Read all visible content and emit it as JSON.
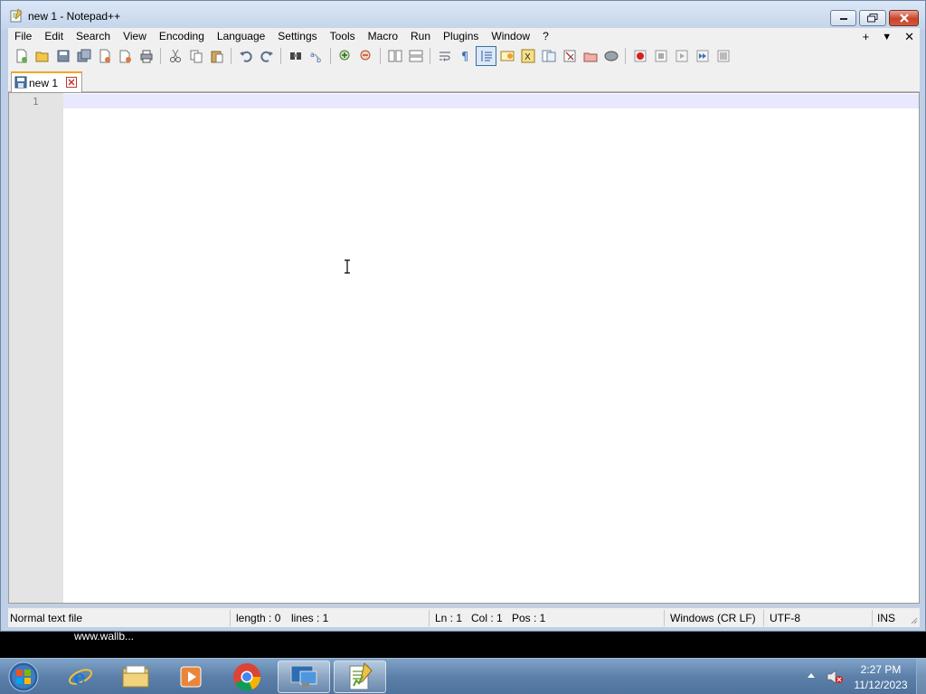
{
  "window": {
    "title": "new 1 - Notepad++",
    "app_icon": "notepadpp-icon"
  },
  "menubar": {
    "items": [
      "File",
      "Edit",
      "Search",
      "View",
      "Encoding",
      "Language",
      "Settings",
      "Tools",
      "Macro",
      "Run",
      "Plugins",
      "Window",
      "?"
    ],
    "right": {
      "plus": "+",
      "dropdown": "▼",
      "close": "✕"
    }
  },
  "toolbar": {
    "icons": [
      "new-file-icon",
      "open-file-icon",
      "save-icon",
      "save-all-icon",
      "close-icon",
      "close-all-icon",
      "print-icon",
      "cut-icon",
      "copy-icon",
      "paste-icon",
      "undo-icon",
      "redo-icon",
      "find-icon",
      "replace-icon",
      "zoom-in-icon",
      "zoom-out-icon",
      "sync-vertical-icon",
      "sync-horizontal-icon",
      "word-wrap-icon",
      "show-all-chars-icon",
      "indent-guide-icon",
      "udl-icon",
      "function-list-icon",
      "doc-map-icon",
      "doc-list-icon",
      "folder-workspace-icon",
      "monitoring-icon",
      "record-macro-icon",
      "stop-macro-icon",
      "play-macro-icon",
      "run-macro-multiple-icon",
      "save-macro-icon"
    ]
  },
  "tabs": [
    {
      "label": "new 1",
      "active": true
    }
  ],
  "editor": {
    "line_numbers": [
      "1"
    ],
    "content": ""
  },
  "statusbar": {
    "file_type": "Normal text file",
    "length": "length : 0",
    "lines": "lines : 1",
    "ln": "Ln : 1",
    "col": "Col : 1",
    "pos": "Pos : 1",
    "eol": "Windows (CR LF)",
    "encoding": "UTF-8",
    "mode": "INS"
  },
  "tooltip": "www.wallb...",
  "taskbar": {
    "apps": [
      "internet-explorer-icon",
      "file-explorer-icon",
      "media-player-icon",
      "chrome-icon",
      "remote-desktop-icon",
      "notepadpp-icon"
    ],
    "time": "2:27 PM",
    "date": "11/12/2023"
  },
  "colors": {
    "title_gradient_top": "#dbe7f6",
    "current_line": "#e8e8ff",
    "gutter": "#e4e4e4",
    "close_red": "#c8442b",
    "tab_accent": "#f5a623"
  }
}
